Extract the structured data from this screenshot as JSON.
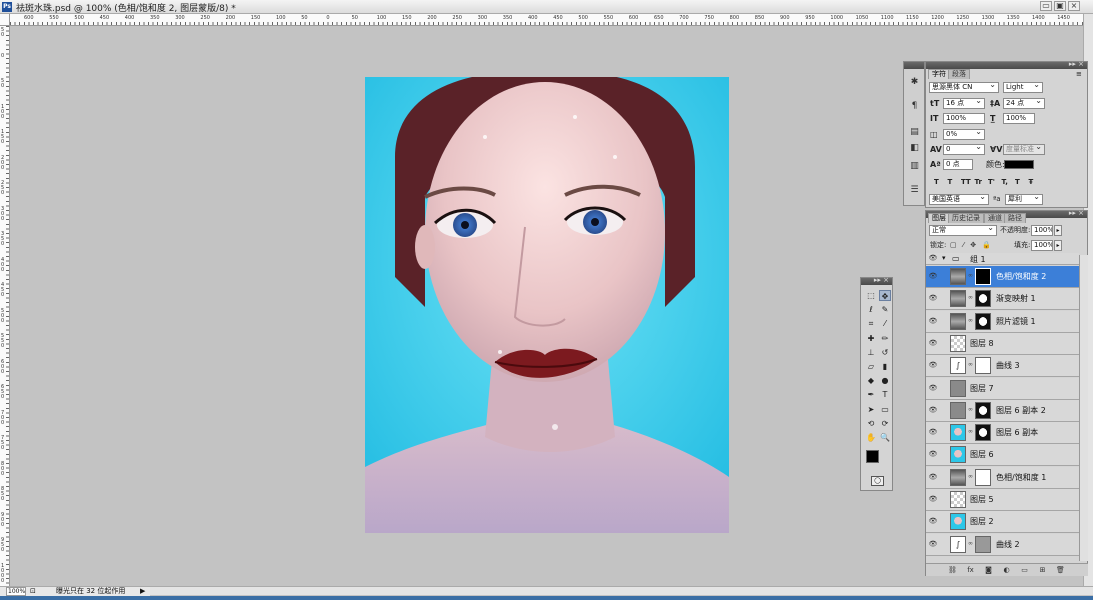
{
  "window": {
    "doc_title": "祛斑水珠.psd @ 100% (色相/饱和度 2, 图层蒙版/8) *",
    "controls": [
      "minimize",
      "restore",
      "close"
    ]
  },
  "rulers": {
    "top_ticks": [
      "600",
      "550",
      "500",
      "450",
      "400",
      "350",
      "300",
      "250",
      "200",
      "150",
      "100",
      "50",
      "0",
      "50",
      "100",
      "150",
      "200",
      "250",
      "300",
      "350",
      "400",
      "450",
      "500",
      "550",
      "600",
      "650",
      "700",
      "750",
      "800",
      "850",
      "900",
      "950",
      "1000",
      "1050",
      "1100",
      "1150",
      "1200",
      "1250",
      "1300",
      "1350",
      "1400",
      "1450"
    ],
    "left_ticks": [
      "50",
      "0",
      "50",
      "100",
      "150",
      "200",
      "250",
      "300",
      "350",
      "400",
      "450",
      "500",
      "550",
      "600",
      "650",
      "700",
      "750",
      "800",
      "850",
      "900",
      "950",
      "1000"
    ]
  },
  "status": {
    "zoom": "100%",
    "message": "曝光只在 32 位起作用"
  },
  "character_panel": {
    "tabs": [
      "字符",
      "段落"
    ],
    "font_family": "思源黑体 CN",
    "font_style": "Light",
    "font_size": "16 点",
    "leading": "24 点",
    "vertical_scale": "100%",
    "horizontal_scale": "100%",
    "tsume": "0%",
    "tracking": "0",
    "kerning": "度量标准",
    "baseline_shift": "0 点",
    "color_label": "颜色:",
    "style_buttons": [
      "T",
      "T",
      "TT",
      "Tr",
      "T'",
      "T,",
      "T",
      "Ŧ"
    ],
    "language": "美国英语",
    "aa_label": "ªa",
    "antialias": "犀利"
  },
  "layers_panel": {
    "tabs": [
      "图层",
      "历史记录",
      "通道",
      "路径"
    ],
    "blend_mode": "正常",
    "opacity_label": "不透明度:",
    "opacity": "100%",
    "lock_label": "锁定:",
    "fill_label": "填充:",
    "fill": "100%",
    "group_name": "组 1",
    "layers": [
      {
        "name": "色相/饱和度 2",
        "kind": "adjustment",
        "mask": "black",
        "selected": true
      },
      {
        "name": "渐变映射 1",
        "kind": "adjustment",
        "mask": "face",
        "selected": false
      },
      {
        "name": "照片滤镜 1",
        "kind": "adjustment",
        "mask": "face",
        "selected": false
      },
      {
        "name": "图层 8",
        "kind": "transparent",
        "mask": "none",
        "selected": false
      },
      {
        "name": "曲线 3",
        "kind": "curves",
        "mask": "white",
        "selected": false
      },
      {
        "name": "图层 7",
        "kind": "gray",
        "mask": "none",
        "selected": false
      },
      {
        "name": "图层 6 副本 2",
        "kind": "gray",
        "mask": "face",
        "selected": false
      },
      {
        "name": "图层 6 副本",
        "kind": "photo",
        "mask": "face",
        "selected": false
      },
      {
        "name": "图层 6",
        "kind": "photo",
        "mask": "none",
        "selected": false
      },
      {
        "name": "色相/饱和度 1",
        "kind": "adjustment",
        "mask": "white",
        "selected": false
      },
      {
        "name": "图层 5",
        "kind": "transparent",
        "mask": "none",
        "selected": false
      },
      {
        "name": "图层 2",
        "kind": "photo",
        "mask": "none",
        "selected": false
      },
      {
        "name": "曲线 2",
        "kind": "curves",
        "mask": "gray",
        "selected": false
      }
    ]
  },
  "tools": {
    "icons": [
      "marquee-icon",
      "move-icon",
      "lasso-icon",
      "quick-select-icon",
      "crop-icon",
      "eyedropper-icon",
      "healing-icon",
      "brush-icon",
      "stamp-icon",
      "history-brush-icon",
      "eraser-icon",
      "gradient-icon",
      "blur-icon",
      "dodge-icon",
      "pen-icon",
      "type-icon",
      "path-select-icon",
      "shape-icon",
      "3d-rotate-icon",
      "3d-orbit-icon",
      "hand-icon",
      "zoom-icon"
    ],
    "foreground_color": "#000000",
    "background_color": "#ffffff"
  },
  "colors": {
    "canvas_bg": "#c3c3c3",
    "selection": "#3c7fd8",
    "photo_bg": "#2dc7e8"
  }
}
